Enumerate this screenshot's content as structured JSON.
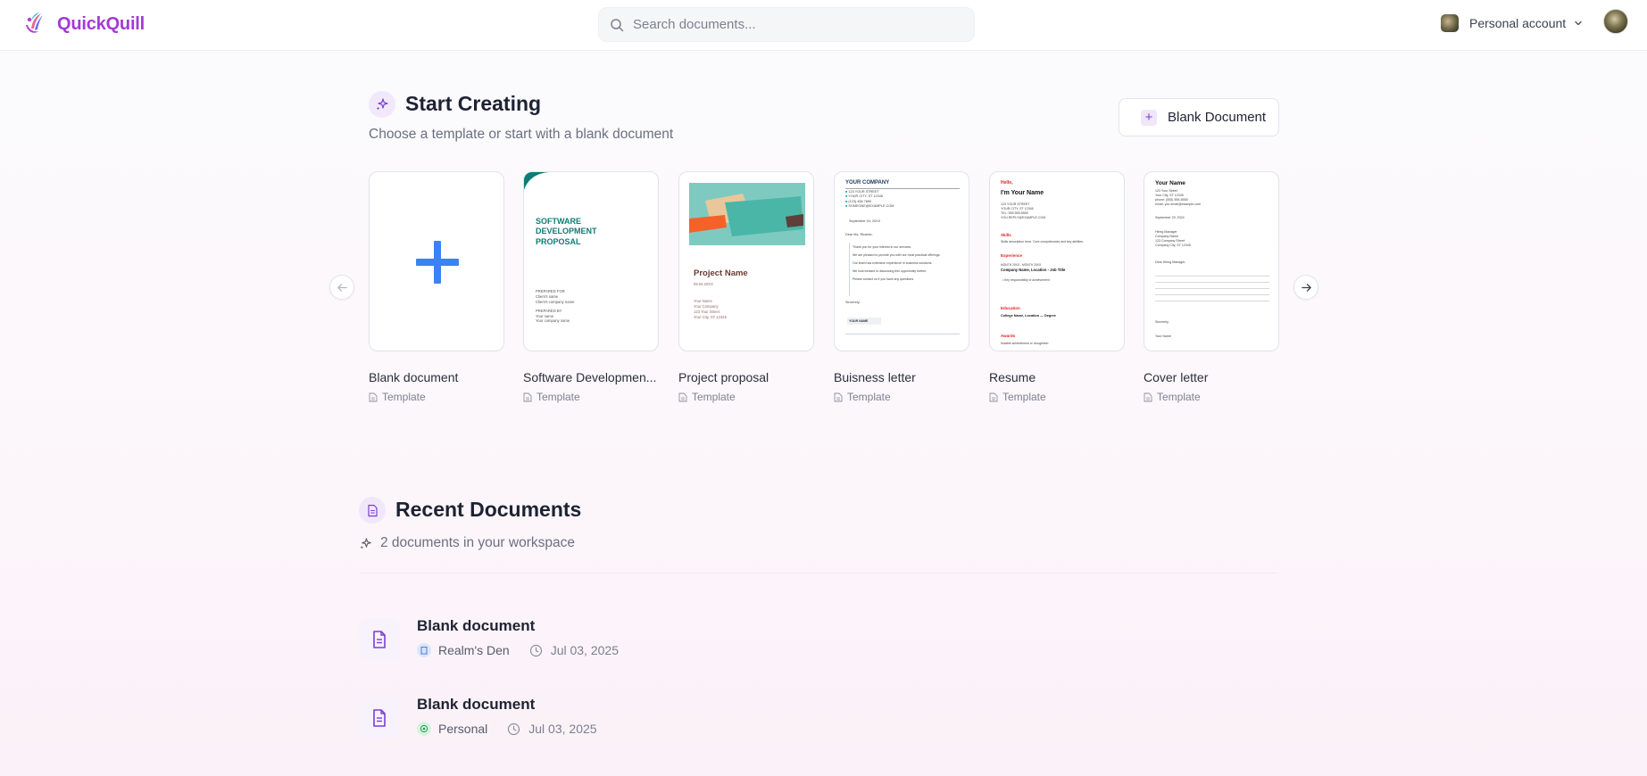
{
  "app": {
    "name": "QuickQuill"
  },
  "search": {
    "placeholder": "Search documents..."
  },
  "account": {
    "label": "Personal account"
  },
  "start": {
    "title": "Start Creating",
    "subtitle": "Choose a template or start with a blank document",
    "blank_button": "Blank Document",
    "templates": [
      {
        "name": "Blank document",
        "type": "Template"
      },
      {
        "name": "Software Developmen...",
        "type": "Template"
      },
      {
        "name": "Project proposal",
        "type": "Template"
      },
      {
        "name": "Buisness letter",
        "type": "Template"
      },
      {
        "name": "Resume",
        "type": "Template"
      },
      {
        "name": "Cover letter",
        "type": "Template"
      }
    ]
  },
  "thumbs": {
    "software": {
      "title1": "SOFTWARE",
      "title2": "DEVELOPMENT",
      "title3": "PROPOSAL",
      "prep_for": "PREPARED FOR",
      "client_name": "Client's name",
      "client_company": "Client's company name",
      "prep_by": "PREPARED BY",
      "your_name": "Your name",
      "your_company": "Your company name"
    },
    "project": {
      "title": "Project Name",
      "date": "09.04.20XX",
      "l1": "Your Name",
      "l2": "Your Company",
      "l3": "123 Your Street",
      "l4": "Your City, ST 12345"
    },
    "letter": {
      "company": "YOUR COMPANY",
      "a1": "123 YOUR STREET",
      "a2": "YOUR CITY, ST 12345",
      "a3": "(123) 456 7890",
      "a4": "SOMEONE@EXAMPLE.COM",
      "date": "September 04, 20XX",
      "greet": "Dear Ms. Ricardo,",
      "p1": "Thank you for your interest in our services.",
      "p2": "We are pleased to provide you with our most practical offerings.",
      "p3": "Our team has extensive experience in business solutions.",
      "p4": "We look forward to discussing this opportunity further.",
      "p5": "Please contact us if you have any questions.",
      "sign": "Sincerely,",
      "btn": "YOUR NAME"
    },
    "resume": {
      "hello": "Hello,",
      "name": "I'm Your Name",
      "a1": "123 YOUR STREET",
      "a2": "YOUR CITY, ST 12345",
      "a3": "TEL: 555.555.5555",
      "a4": "YOU.REPLY@EXAMPLE.COM",
      "skills": "Skills",
      "skills_t": "Skills description here. Core competencies and key abilities.",
      "exp": "Experience",
      "exp_d": "MONTH 20XX - MONTH 20XX",
      "exp_t": "Company Name, Location - Job Title",
      "exp_b": "Key responsibility or achievement",
      "edu": "Education",
      "edu_t": "College Name, Location — Degree",
      "awards": "Awards",
      "awards_t": "Notable achievement or recognition"
    },
    "cover": {
      "name": "Your Name",
      "a1": "123 Your Street",
      "a2": "Your City, ST 12345",
      "a3": "phone: (555) 555-5555",
      "a4": "email: you.email@example.com",
      "date": "September 29, 2024",
      "r1": "Hiring Manager",
      "r2": "Company Name",
      "r3": "123 Company Street",
      "r4": "Company City, ST 12345",
      "greet": "Dear Hiring Manager,",
      "sign": "Sincerely,",
      "sig_name": "Your Name"
    }
  },
  "recent": {
    "title": "Recent Documents",
    "subtitle": "2 documents in your workspace",
    "docs": [
      {
        "title": "Blank document",
        "workspace": "Realm's Den",
        "date": "Jul 03, 2025",
        "badge_color": "#dbe6fb"
      },
      {
        "title": "Blank document",
        "workspace": "Personal",
        "date": "Jul 03, 2025",
        "badge_color": "#d6f3de"
      }
    ]
  },
  "colors": {
    "brand": "#a23ad6",
    "accent": "#7a3fd0",
    "plus_blue": "#3b82f6"
  }
}
